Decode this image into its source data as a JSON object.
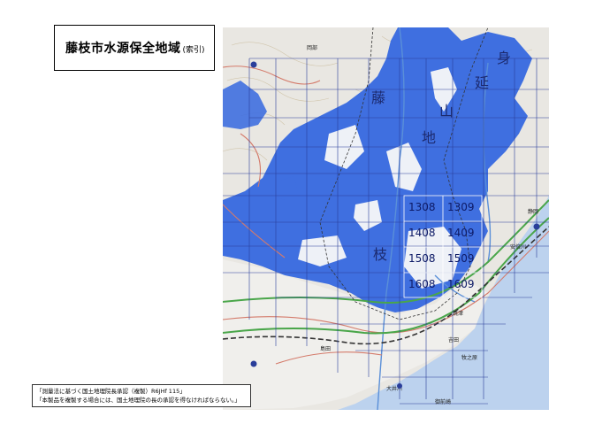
{
  "title": {
    "main": "藤枝市水源保全地域",
    "sub": "(索引)"
  },
  "notice": {
    "line1": "「測量法に基づく国土地理院長承認（複製）R6JHf 115」",
    "line2": "「本製品を複製する場合には、国土地理院の長の承認を得なければならない。」"
  },
  "map": {
    "colors": {
      "conservation_area": "#3f6fe0",
      "land": "#e9e7e2",
      "sea": "#bcd2ee",
      "grid": "#2a3e9a",
      "road": "#d47a6a",
      "expressway": "#4aa64a",
      "railway": "#333333"
    },
    "sheets": [
      {
        "id": "1308",
        "label": "1308"
      },
      {
        "id": "1309",
        "label": "1309"
      },
      {
        "id": "1408",
        "label": "1408"
      },
      {
        "id": "1409",
        "label": "1409"
      },
      {
        "id": "1508",
        "label": "1508"
      },
      {
        "id": "1509",
        "label": "1509"
      },
      {
        "id": "1608",
        "label": "1608"
      },
      {
        "id": "1609",
        "label": "1609"
      }
    ],
    "kanji_labels": [
      "身",
      "延",
      "山",
      "地",
      "藤",
      "枝"
    ],
    "place_labels": [
      "岡部",
      "焼津",
      "吉田",
      "牧之原",
      "大井川",
      "安倍川",
      "静岡",
      "島田",
      "御前崎"
    ]
  }
}
